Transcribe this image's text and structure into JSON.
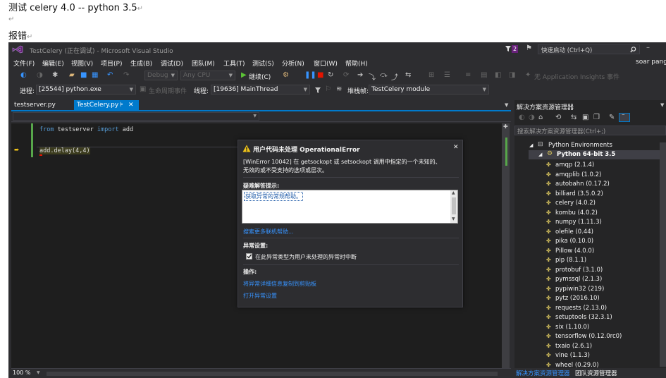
{
  "doc": {
    "line1": "测试 celery 4.0    -- python 3.5",
    "line2_mark": "↵",
    "line3": "报错",
    "para_mark": "↵"
  },
  "vs": {
    "title": "TestCelery (正在调试) - Microsoft Visual Studio",
    "notification_count": "2",
    "quick_launch_placeholder": "快速启动 (Ctrl+Q)",
    "user": "soar pang",
    "menu": [
      "文件(F)",
      "编辑(E)",
      "视图(V)",
      "项目(P)",
      "生成(B)",
      "调试(D)",
      "团队(M)",
      "工具(T)",
      "测试(S)",
      "分析(N)",
      "窗口(W)",
      "帮助(H)"
    ],
    "toolbar": {
      "config": "Debug",
      "platform": "Any CPU",
      "continue_label": "继续(C)",
      "insights": "无 Application Insights 事件"
    },
    "debug_location": {
      "process_label": "进程:",
      "process": "[25544] python.exe",
      "lifecycle": "生命周期事件",
      "thread_label": "线程:",
      "thread": "[19636] MainThread",
      "stack_label": "堆栈帧:",
      "stack": "TestCelery module"
    },
    "tabs": {
      "tab1": "testserver.py",
      "tab2": "TestCelery.py",
      "pin": "⊧",
      "close": "✕"
    },
    "code": {
      "kw_from": "from",
      "module": "testserver",
      "kw_import": "import",
      "name": "add",
      "line2": "add.delay(4,4)"
    },
    "zoom": "100 %",
    "dialog": {
      "title": "用户代码未处理 OperationalError",
      "message_line1": "[WinError 10042] 在 getsockopt 或 setsockopt 调用中指定的一个未知的、",
      "message_line2": "无效的或不受支持的选项或层次。",
      "tips_header": "疑难解答提示:",
      "tip_item": "获取异常的常规帮助。",
      "search_link": "搜索更多联机帮助...",
      "settings_header": "异常设置:",
      "break_option": "在此异常类型为用户未处理的异常时中断",
      "actions_header": "操作:",
      "copy_link": "将异常详细信息复制到剪贴板",
      "open_settings_link": "打开异常设置"
    },
    "solution_explorer": {
      "title": "解决方案资源管理器",
      "search_placeholder": "搜索解决方案资源管理器(Ctrl+;)",
      "env_root": "Python Environments",
      "env": "Python 64-bit 3.5",
      "packages": [
        "amqp (2.1.4)",
        "amqplib (1.0.2)",
        "autobahn (0.17.2)",
        "billiard (3.5.0.2)",
        "celery (4.0.2)",
        "kombu (4.0.2)",
        "numpy (1.11.3)",
        "olefile (0.44)",
        "pika (0.10.0)",
        "Pillow (4.0.0)",
        "pip (8.1.1)",
        "protobuf (3.1.0)",
        "pymssql (2.1.3)",
        "pypiwin32 (219)",
        "pytz (2016.10)",
        "requests (2.13.0)",
        "setuptools (32.3.1)",
        "six (1.10.0)",
        "tensorflow (0.12.0rc0)",
        "txaio (2.6.1)",
        "vine (1.1.3)",
        "wheel (0.29.0)"
      ],
      "bottom_tab1": "解决方案资源管理器",
      "bottom_tab2": "团队资源管理器"
    },
    "colors": {
      "accent": "#007acc",
      "window_bg": "#2d2d30",
      "editor_bg": "#1e1e1e",
      "link": "#3794ff",
      "warning": "#f0c419"
    }
  }
}
